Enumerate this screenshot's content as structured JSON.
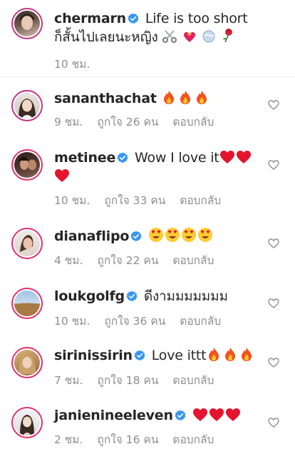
{
  "caption": {
    "username": "chermarn",
    "verified": true,
    "text": "Life is too short ก็สั้นไปเลยนะหญิง",
    "emojis": [
      "scissors",
      "fire-heart",
      "globe",
      "rose"
    ],
    "time": "10 ชม."
  },
  "comments": [
    {
      "username": "sananthachat",
      "verified": false,
      "text": "",
      "emojis": [
        "fire",
        "fire",
        "fire"
      ],
      "time": "9 ชม.",
      "likes": "ถูกใจ 26 คน",
      "reply": "ตอบกลับ"
    },
    {
      "username": "metinee",
      "verified": true,
      "text": "Wow I love it",
      "emojis": [
        "red-heart",
        "red-heart",
        "red-heart"
      ],
      "time": "10 ชม.",
      "likes": "ถูกใจ 33 คน",
      "reply": "ตอบกลับ"
    },
    {
      "username": "dianaflipo",
      "verified": true,
      "text": "",
      "emojis": [
        "heart-eyes",
        "heart-eyes",
        "heart-eyes",
        "heart-eyes"
      ],
      "time": "4 ชม.",
      "likes": "ถูกใจ 22 คน",
      "reply": "ตอบกลับ"
    },
    {
      "username": "loukgolfg",
      "verified": true,
      "text": "ดีงามมมมมมม",
      "emojis": [],
      "time": "10 ชม.",
      "likes": "ถูกใจ 36 คน",
      "reply": "ตอบกลับ"
    },
    {
      "username": "sirinissirin",
      "verified": true,
      "text": "Love ittt",
      "emojis": [
        "fire",
        "fire",
        "fire"
      ],
      "time": "7 ชม.",
      "likes": "ถูกใจ 18 คน",
      "reply": "ตอบกลับ"
    },
    {
      "username": "janienineeleven",
      "verified": true,
      "text": "",
      "emojis": [
        "red-heart",
        "red-heart",
        "red-heart"
      ],
      "time": "2 ชม.",
      "likes": "ถูกใจ 16 คน",
      "reply": "ตอบกลับ"
    }
  ],
  "colors": {
    "verified_blue": "#3897f0",
    "meta_gray": "#8e8e8e",
    "text": "#262626",
    "avatar_ring": "#c13584"
  }
}
